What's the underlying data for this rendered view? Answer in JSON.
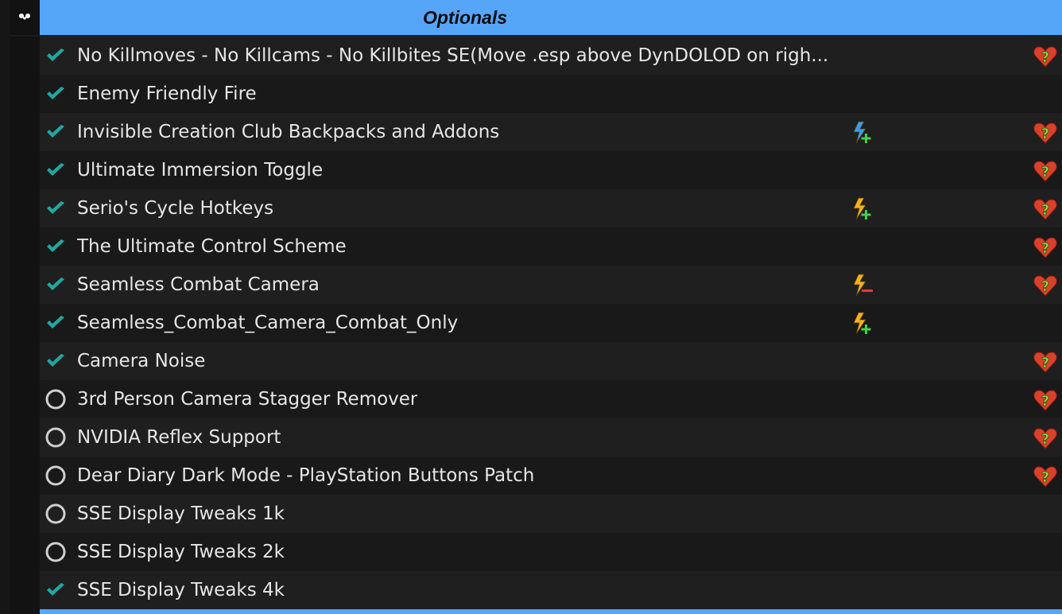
{
  "separator": {
    "title": "Optionals",
    "collapse_icon": "chevron-down-icon",
    "color": "#55a6f9"
  },
  "plugins": [
    {
      "name": "No Killmoves - No Killcams - No Killbites SE(Move .esp above DynDOLOD on righ...",
      "enabled": true,
      "flag": null,
      "warning": true
    },
    {
      "name": "Enemy Friendly Fire",
      "enabled": true,
      "flag": null,
      "warning": false
    },
    {
      "name": "Invisible Creation Club Backpacks and Addons",
      "enabled": true,
      "flag": "esl-plus-blue",
      "warning": true
    },
    {
      "name": "Ultimate Immersion Toggle",
      "enabled": true,
      "flag": null,
      "warning": true
    },
    {
      "name": "Serio's Cycle Hotkeys",
      "enabled": true,
      "flag": "esl-plus",
      "warning": true
    },
    {
      "name": "The Ultimate Control Scheme",
      "enabled": true,
      "flag": null,
      "warning": true
    },
    {
      "name": "Seamless Combat Camera",
      "enabled": true,
      "flag": "esl-minus",
      "warning": true
    },
    {
      "name": "Seamless_Combat_Camera_Combat_Only",
      "enabled": true,
      "flag": "esl-plus",
      "warning": false
    },
    {
      "name": "Camera Noise",
      "enabled": true,
      "flag": null,
      "warning": true
    },
    {
      "name": "3rd Person Camera Stagger Remover",
      "enabled": false,
      "flag": null,
      "warning": true
    },
    {
      "name": "NVIDIA Reflex Support",
      "enabled": false,
      "flag": null,
      "warning": true
    },
    {
      "name": "Dear Diary Dark Mode - PlayStation Buttons Patch",
      "enabled": false,
      "flag": null,
      "warning": true
    },
    {
      "name": "SSE Display Tweaks 1k",
      "enabled": false,
      "flag": null,
      "warning": false
    },
    {
      "name": "SSE Display Tweaks 2k",
      "enabled": false,
      "flag": null,
      "warning": false
    },
    {
      "name": "SSE Display Tweaks 4k",
      "enabled": true,
      "flag": null,
      "warning": false
    }
  ],
  "colors": {
    "check": "#1fa8a0",
    "heart": "#d9412b",
    "question": "#7fe03a",
    "bolt_yellow": "#f2b21e",
    "bolt_blue": "#3a9cf0",
    "plus": "#3fd14a",
    "minus": "#e8363a"
  }
}
